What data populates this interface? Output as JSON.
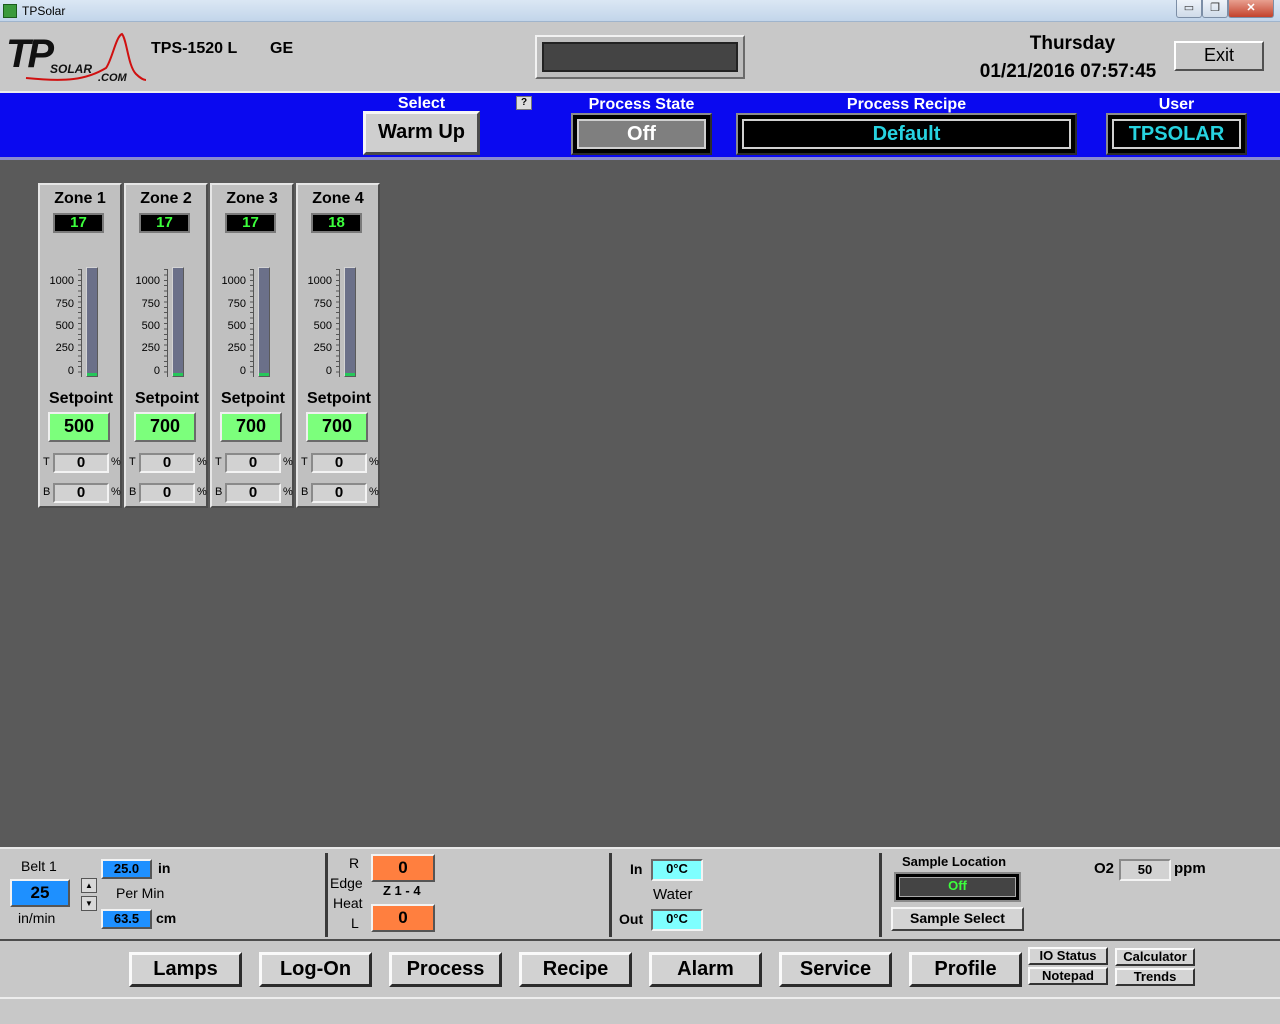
{
  "window": {
    "title": "TPSolar",
    "minimize": "▭",
    "maximize": "❐",
    "close": "✕"
  },
  "header": {
    "logo": {
      "tp": "TP",
      "solar": "SOLAR",
      "com": ".COM",
      "accent": "#d01010"
    },
    "model": "TPS-1520 L",
    "model_suffix": "GE",
    "day": "Thursday",
    "datetime": "01/21/2016 07:57:45",
    "exit_label": "Exit"
  },
  "band": {
    "select_label": "Select",
    "warm_label": "Warm Up",
    "help": "?",
    "process_state_label": "Process State",
    "process_state": "Off",
    "process_recipe_label": "Process Recipe",
    "process_recipe": "Default",
    "user_label": "User",
    "user": "TPSOLAR",
    "colors": {
      "band": "#0a09f0",
      "recipe_text": "#27d3e0"
    }
  },
  "zones": [
    {
      "title": "Zone 1",
      "temp": "17",
      "setpoint_label": "Setpoint",
      "setpoint": "500",
      "t_label": "T",
      "t_value": "0",
      "b_label": "B",
      "b_value": "0",
      "pct": "%",
      "level": 0.017
    },
    {
      "title": "Zone 2",
      "temp": "17",
      "setpoint_label": "Setpoint",
      "setpoint": "700",
      "t_label": "T",
      "t_value": "0",
      "b_label": "B",
      "b_value": "0",
      "pct": "%",
      "level": 0.017
    },
    {
      "title": "Zone 3",
      "temp": "17",
      "setpoint_label": "Setpoint",
      "setpoint": "700",
      "t_label": "T",
      "t_value": "0",
      "b_label": "B",
      "b_value": "0",
      "pct": "%",
      "level": 0.017
    },
    {
      "title": "Zone 4",
      "temp": "18",
      "setpoint_label": "Setpoint",
      "setpoint": "700",
      "t_label": "T",
      "t_value": "0",
      "b_label": "B",
      "b_value": "0",
      "pct": "%",
      "level": 0.018
    }
  ],
  "scale_labels": [
    "1000",
    "750",
    "500",
    "250",
    "0"
  ],
  "belt": {
    "label": "Belt 1",
    "value": "25",
    "unit": "in/min",
    "up": "▲",
    "down": "▼",
    "in_value": "25.0",
    "in_unit": "in",
    "per_min": "Per Min",
    "cm_value": "63.5",
    "cm_unit": "cm"
  },
  "edge_heat": {
    "r_label": "R",
    "edge_label": "Edge",
    "heat_label": "Heat",
    "l_label": "L",
    "zone_label": "Z 1 - 4",
    "r_value": "0",
    "l_value": "0"
  },
  "water": {
    "in_label": "In",
    "in_value": "0°C",
    "title": "Water",
    "out_label": "Out",
    "out_value": "0°C"
  },
  "sample": {
    "location_label": "Sample Location",
    "state": "Off",
    "select_label": "Sample Select"
  },
  "o2": {
    "label": "O2",
    "value": "50",
    "unit": "ppm"
  },
  "nav": {
    "buttons": [
      "Lamps",
      "Log-On",
      "Process",
      "Recipe",
      "Alarm",
      "Service",
      "Profile"
    ],
    "io_status": "IO Status",
    "notepad": "Notepad",
    "calculator": "Calculator",
    "trends": "Trends"
  }
}
